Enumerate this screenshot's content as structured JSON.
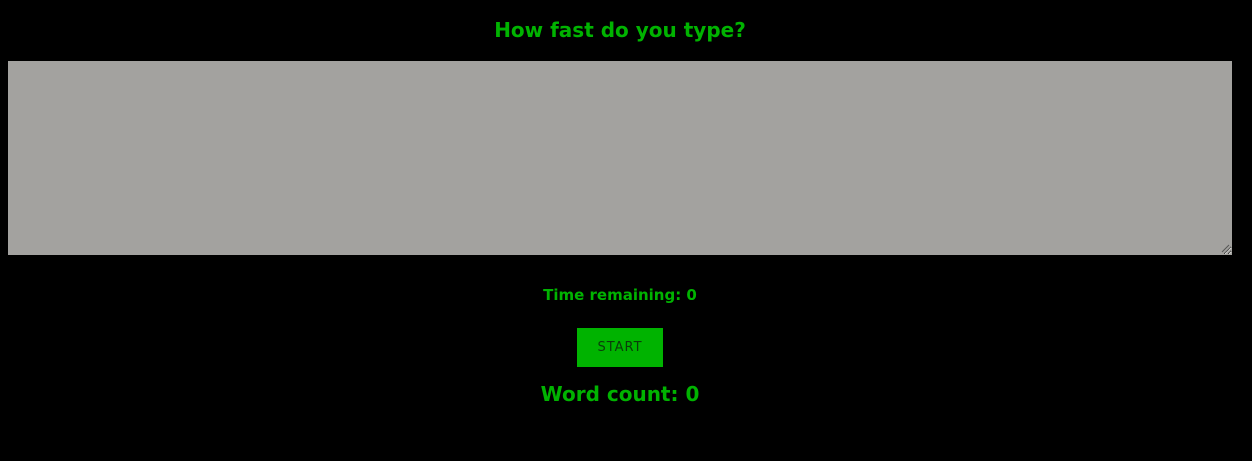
{
  "header": {
    "title": "How fast do you type?"
  },
  "typing_area": {
    "value": "",
    "placeholder": ""
  },
  "timer": {
    "text": "Time remaining: 0"
  },
  "controls": {
    "start_label": "START"
  },
  "stats": {
    "word_count_text": "Word count: 0"
  },
  "colors": {
    "background": "#000000",
    "accent_green": "#00b300",
    "textarea_bg": "#a3a29f",
    "button_text": "#0a3d0a"
  }
}
